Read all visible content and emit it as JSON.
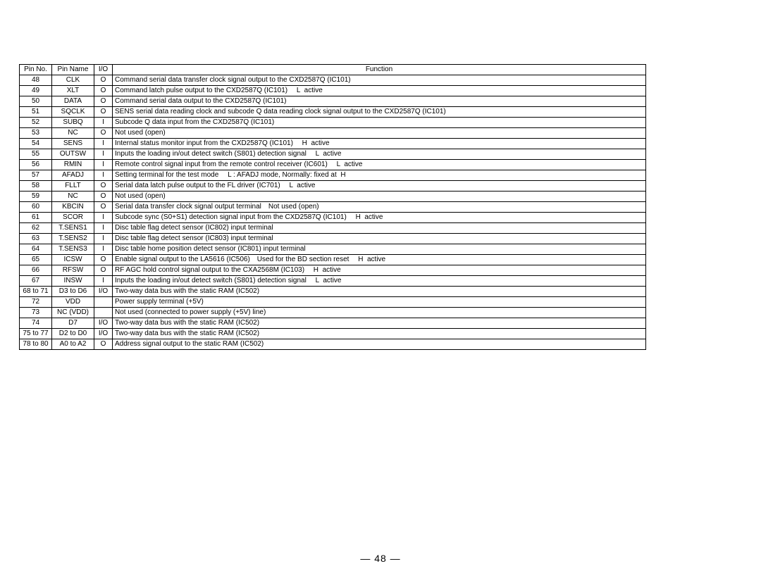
{
  "page_number_text": "— 48 —",
  "table": {
    "headers": [
      "Pin No.",
      "Pin Name",
      "I/O",
      "Function"
    ],
    "rows": [
      {
        "pin_no": "48",
        "pin_name": "CLK",
        "io": "O",
        "func": "Command serial data transfer clock signal output to the CXD2587Q (IC101)"
      },
      {
        "pin_no": "49",
        "pin_name": "XLT",
        "io": "O",
        "func": "Command latch pulse output to the CXD2587Q (IC101)  L  active"
      },
      {
        "pin_no": "50",
        "pin_name": "DATA",
        "io": "O",
        "func": "Command serial data output to the CXD2587Q (IC101)"
      },
      {
        "pin_no": "51",
        "pin_name": "SQCLK",
        "io": "O",
        "func": "SENS serial data reading clock and subcode Q data reading clock signal output to the CXD2587Q (IC101)"
      },
      {
        "pin_no": "52",
        "pin_name": "SUBQ",
        "io": "I",
        "func": "Subcode Q data input from the CXD2587Q (IC101)"
      },
      {
        "pin_no": "53",
        "pin_name": "NC",
        "io": "O",
        "func": "Not used (open)"
      },
      {
        "pin_no": "54",
        "pin_name": "SENS",
        "io": "I",
        "func": "Internal status monitor input from the CXD2587Q (IC101)  H  active"
      },
      {
        "pin_no": "55",
        "pin_name": "OUTSW",
        "io": "I",
        "func": "Inputs the loading in/out detect switch (S801) detection signal  L  active"
      },
      {
        "pin_no": "56",
        "pin_name": "RMIN",
        "io": "I",
        "func": "Remote control signal input from the remote control receiver (IC601)  L  active"
      },
      {
        "pin_no": "57",
        "pin_name": "AFADJ",
        "io": "I",
        "func": "Setting terminal for the test mode  L : AFADJ mode, Normally: fixed at  H"
      },
      {
        "pin_no": "58",
        "pin_name": "FLLT",
        "io": "O",
        "func": "Serial data latch pulse output to the FL driver (IC701)  L  active"
      },
      {
        "pin_no": "59",
        "pin_name": "NC",
        "io": "O",
        "func": "Not used (open)"
      },
      {
        "pin_no": "60",
        "pin_name": "KBCIN",
        "io": "O",
        "func": "Serial data transfer clock signal output terminal Not used (open)"
      },
      {
        "pin_no": "61",
        "pin_name": "SCOR",
        "io": "I",
        "func": "Subcode sync (S0+S1) detection signal input from the CXD2587Q (IC101)  H  active"
      },
      {
        "pin_no": "62",
        "pin_name": "T.SENS1",
        "io": "I",
        "func": "Disc table flag detect sensor (IC802) input terminal"
      },
      {
        "pin_no": "63",
        "pin_name": "T.SENS2",
        "io": "I",
        "func": "Disc table flag detect sensor (IC803) input terminal"
      },
      {
        "pin_no": "64",
        "pin_name": "T.SENS3",
        "io": "I",
        "func": "Disc table home position detect sensor (IC801) input terminal"
      },
      {
        "pin_no": "65",
        "pin_name": "ICSW",
        "io": "O",
        "func": "Enable signal output to the LA5616 (IC506) Used for the BD section reset  H  active"
      },
      {
        "pin_no": "66",
        "pin_name": "RFSW",
        "io": "O",
        "func": "RF AGC hold control signal output to the CXA2568M (IC103)  H  active"
      },
      {
        "pin_no": "67",
        "pin_name": "INSW",
        "io": "I",
        "func": "Inputs the loading in/out detect switch (S801) detection signal  L  active"
      },
      {
        "pin_no": "68 to 71",
        "pin_name": "D3 to D6",
        "io": "I/O",
        "func": "Two-way data bus with the static RAM (IC502)"
      },
      {
        "pin_no": "72",
        "pin_name": "VDD",
        "io": "",
        "func": "Power supply terminal (+5V)"
      },
      {
        "pin_no": "73",
        "pin_name": "NC (VDD)",
        "io": "",
        "func": "Not used (connected to power supply (+5V) line)"
      },
      {
        "pin_no": "74",
        "pin_name": "D7",
        "io": "I/O",
        "func": "Two-way data bus with the static RAM (IC502)"
      },
      {
        "pin_no": "75 to 77",
        "pin_name": "D2 to D0",
        "io": "I/O",
        "func": "Two-way data bus with the static RAM (IC502)"
      },
      {
        "pin_no": "78 to 80",
        "pin_name": "A0 to A2",
        "io": "O",
        "func": "Address signal output to the static RAM (IC502)"
      }
    ]
  }
}
